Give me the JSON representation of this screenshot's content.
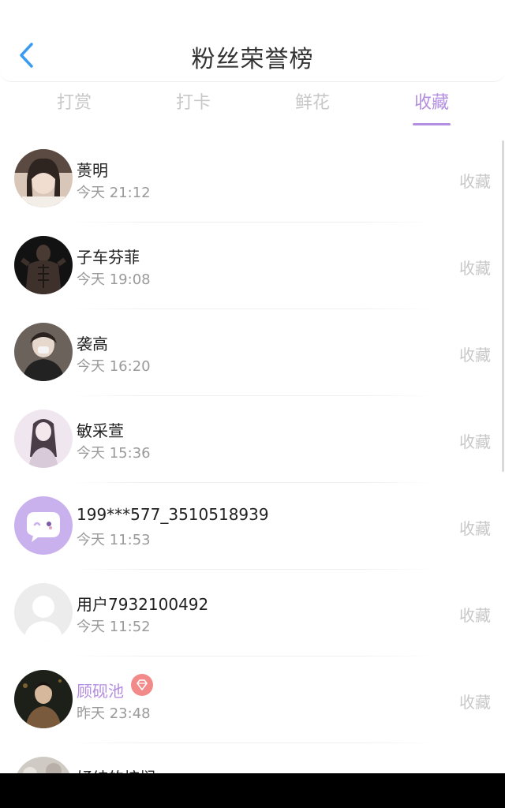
{
  "header": {
    "title": "粉丝荣誉榜",
    "back_icon": "chevron-left-icon"
  },
  "tabs": [
    {
      "label": "打赏",
      "active": false
    },
    {
      "label": "打卡",
      "active": false
    },
    {
      "label": "鲜花",
      "active": false
    },
    {
      "label": "收藏",
      "active": true
    }
  ],
  "colors": {
    "accent": "#b48ee0",
    "muted": "#c8c8c8",
    "badge": "#f28a8a"
  },
  "fans": [
    {
      "name": "蒉明",
      "time": "今天 21:12",
      "action": "收藏",
      "avatar": "photo-avatar"
    },
    {
      "name": "子车芬菲",
      "time": "今天 19:08",
      "action": "收藏",
      "avatar": "photo-avatar"
    },
    {
      "name": "袭高",
      "time": "今天 16:20",
      "action": "收藏",
      "avatar": "photo-avatar"
    },
    {
      "name": "敏采萱",
      "time": "今天 15:36",
      "action": "收藏",
      "avatar": "photo-avatar"
    },
    {
      "name": "199***577_3510518939",
      "time": "今天 11:53",
      "action": "收藏",
      "avatar": "chat-bubble-avatar"
    },
    {
      "name": "用户7932100492",
      "time": "今天 11:52",
      "action": "收藏",
      "avatar": "default-user-avatar"
    },
    {
      "name": "顾砚池",
      "time": "昨天 23:48",
      "action": "收藏",
      "avatar": "photo-avatar",
      "badge": "diamond-icon"
    },
    {
      "name": "妤纯的棕榈",
      "avatar": "photo-avatar"
    }
  ]
}
